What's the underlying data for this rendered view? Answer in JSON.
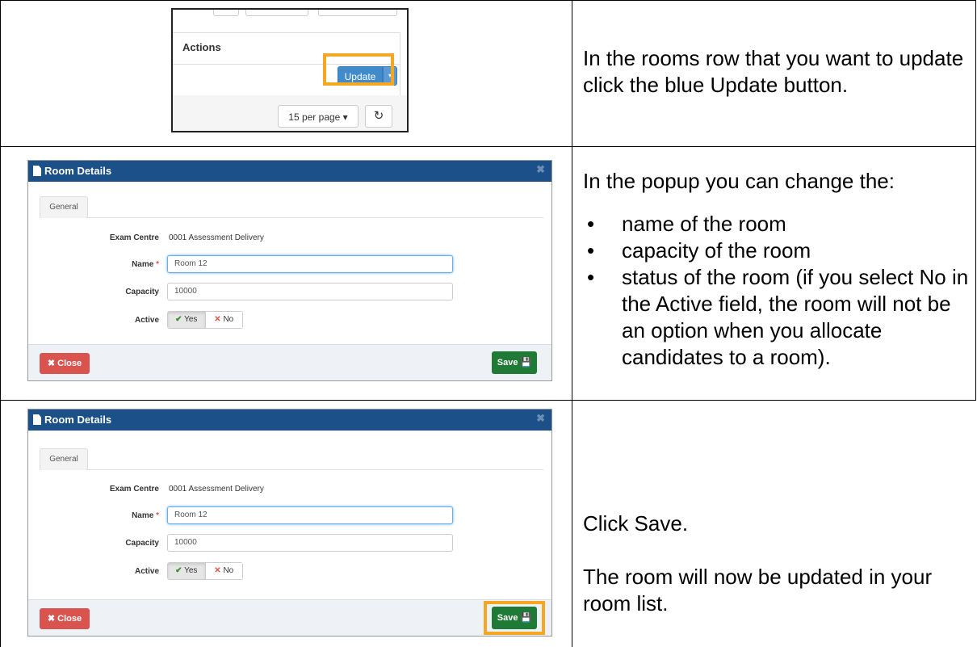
{
  "row1": {
    "screenshot": {
      "actions_header": "Actions",
      "update_label": "Update",
      "caret": "▾",
      "per_page_label": "15 per page ▾",
      "refresh_icon": "↻"
    },
    "instruction": "In the rooms row that you want to update click the blue Update button."
  },
  "row2": {
    "modal": {
      "title": "Room Details",
      "close_x": "✖",
      "tab_general": "General",
      "exam_centre_label": "Exam Centre",
      "exam_centre_value": "0001 Assessment Delivery",
      "name_label": "Name",
      "required_mark": "*",
      "name_value": "Room 12",
      "capacity_label": "Capacity",
      "capacity_value": "10000",
      "active_label": "Active",
      "yes_label": "Yes",
      "no_label": "No",
      "close_label": "Close",
      "save_label": "Save"
    },
    "instruction_intro": "In the popup you can change the:",
    "bullets": [
      "name of the room",
      "capacity of the room",
      "status of the room (if you select No in the Active field, the room will not be an option when you allocate candidates to a room)."
    ]
  },
  "row3": {
    "modal": {
      "title": "Room Details",
      "close_x": "✖",
      "tab_general": "General",
      "exam_centre_label": "Exam Centre",
      "exam_centre_value": "0001 Assessment Delivery",
      "name_label": "Name",
      "required_mark": "*",
      "name_value": "Room 12",
      "capacity_label": "Capacity",
      "capacity_value": "10000",
      "active_label": "Active",
      "yes_label": "Yes",
      "no_label": "No",
      "close_label": "Close",
      "save_label": "Save"
    },
    "instruction_1": "Click Save.",
    "instruction_2": "The room will now be updated in your room list."
  },
  "colors": {
    "modal_header": "#1b5089",
    "update_blue": "#428bca",
    "highlight_orange": "#f5a623",
    "close_red": "#d9534f",
    "save_green": "#1e7a34"
  }
}
